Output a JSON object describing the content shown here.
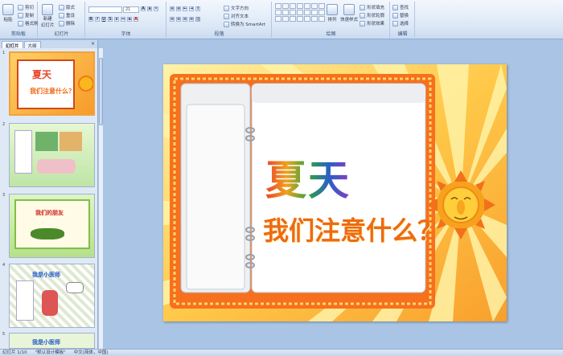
{
  "ribbon": {
    "clipboard": {
      "label": "剪贴板",
      "paste": "粘贴",
      "cut": "剪切",
      "copy": "复制",
      "format_painter": "格式刷"
    },
    "slides": {
      "label": "幻灯片",
      "new_slide": "新建",
      "new_slide2": "幻灯片",
      "layout": "版式",
      "reset": "重设",
      "delete": "删除"
    },
    "font": {
      "label": "字体",
      "font_size": "21"
    },
    "paragraph": {
      "label": "段落",
      "text_direction": "文字方向",
      "align_text": "对齐文本",
      "convert_smartart": "转换为 SmartArt"
    },
    "drawing": {
      "label": "绘图",
      "arrange": "排列",
      "quick_styles": "快速样式",
      "shape_fill": "形状填充",
      "shape_outline": "形状轮廓",
      "shape_effects": "形状效果"
    },
    "editing": {
      "label": "编辑",
      "find": "查找",
      "replace": "替换",
      "select": "选择"
    }
  },
  "panel": {
    "tab_slides": "幻灯片",
    "tab_outline": "大纲",
    "close": "×",
    "thumbs": [
      {
        "num": "1",
        "title": "夏天",
        "sub": "我们注意什么？"
      },
      {
        "num": "2"
      },
      {
        "num": "3",
        "title": "我们的朋友"
      },
      {
        "num": "4",
        "title": "我是小医师"
      },
      {
        "num": "5",
        "title": "我是小医师"
      }
    ]
  },
  "slide": {
    "title": "夏天",
    "subtitle": "我们注意什么？",
    "title_colors": [
      "#e8442a",
      "#f0a21e",
      "#2fa43c",
      "#2a5fc8",
      "#8a3cc0"
    ]
  },
  "status": {
    "slide_counter": "幻灯片 1/10",
    "theme": "\"默认设计模板\"",
    "language": "中文(简体，中国)"
  }
}
